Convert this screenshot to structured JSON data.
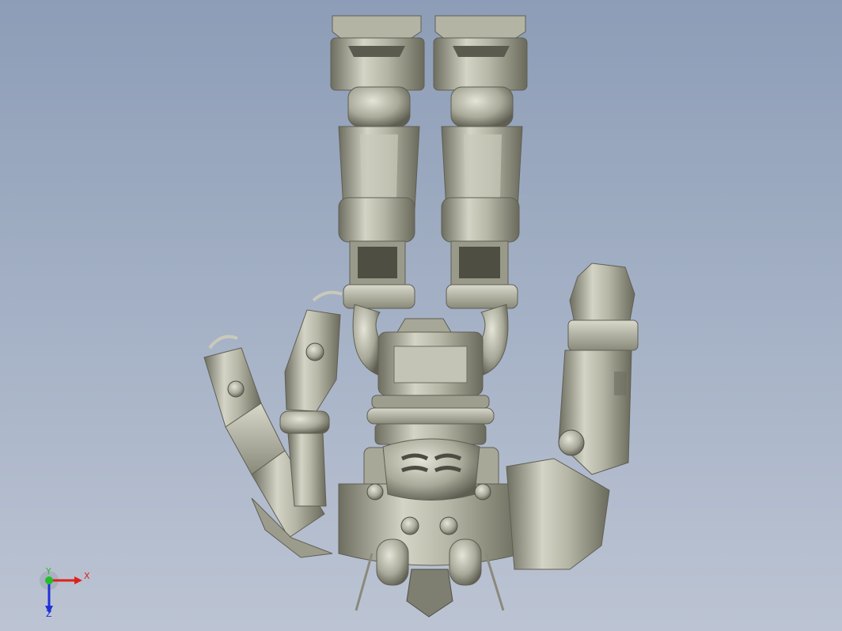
{
  "viewport": {
    "model": {
      "name": "robotic-hand-cad-model"
    },
    "triad": {
      "x_label": "X",
      "y_label": "Y",
      "z_label": "Z",
      "colors": {
        "x": "#e0201a",
        "y": "#1fbf2a",
        "z": "#2030d8"
      }
    }
  }
}
